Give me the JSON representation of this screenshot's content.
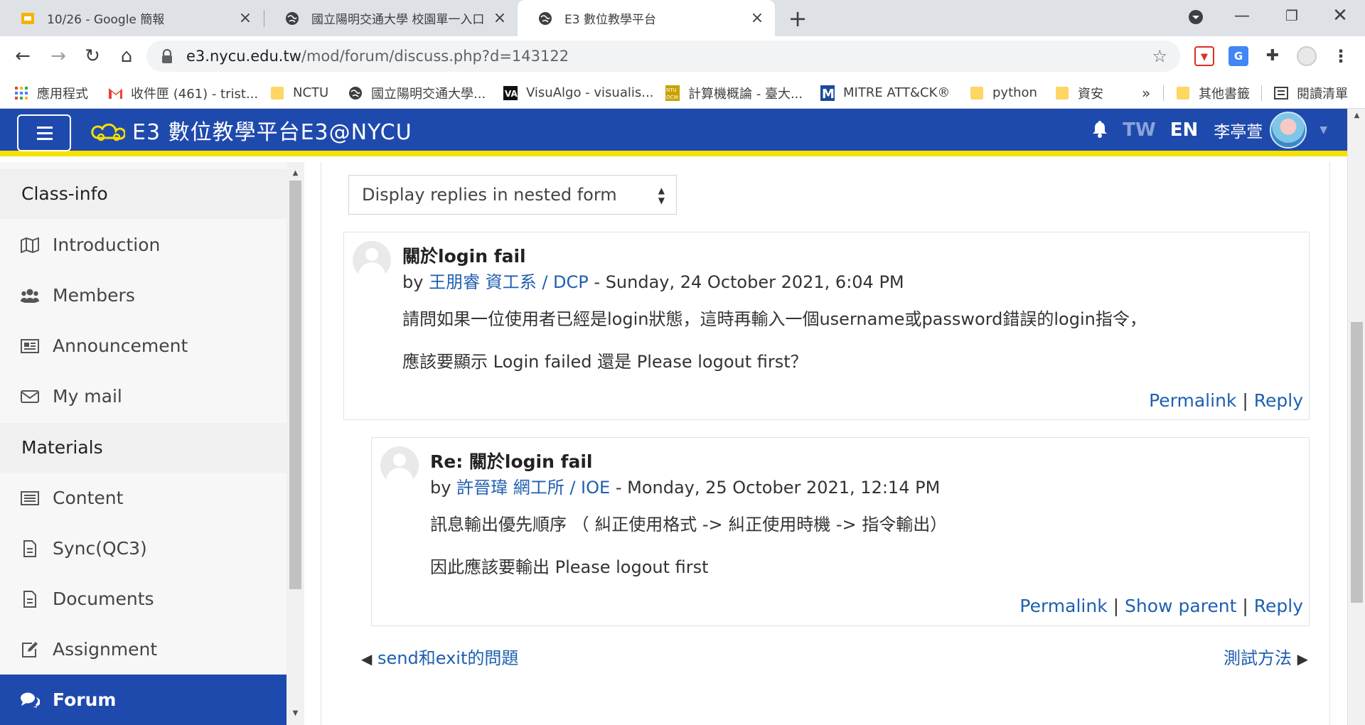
{
  "browser": {
    "tabs": [
      {
        "title": "10/26 - Google 簡報",
        "icon": "google-slides-icon"
      },
      {
        "title": "國立陽明交通大學 校園單一入口",
        "icon": "globe-icon"
      },
      {
        "title": "E3 數位教學平台",
        "icon": "globe-icon",
        "active": true
      }
    ],
    "url_host": "e3.nycu.edu.tw",
    "url_path": "/mod/forum/discuss.php?d=143122",
    "bookmarks": [
      {
        "label": "應用程式",
        "icon": "apps-grid-icon"
      },
      {
        "label": "收件匣 (461) - trist...",
        "icon": "gmail-icon"
      },
      {
        "label": "NCTU",
        "icon": "folder-icon"
      },
      {
        "label": "國立陽明交通大學...",
        "icon": "globe-icon"
      },
      {
        "label": "VisuAlgo - visualis...",
        "icon": "visualgo-icon"
      },
      {
        "label": "計算機概論 - 臺大...",
        "icon": "ntu-ocw-icon"
      },
      {
        "label": "MITRE ATT&CK®",
        "icon": "mitre-icon"
      },
      {
        "label": "python",
        "icon": "folder-icon"
      },
      {
        "label": "資安",
        "icon": "folder-icon"
      }
    ],
    "bookmarks_overflow": "»",
    "other_bookmarks": "其他書籤",
    "reading_list": "閱讀清單"
  },
  "app": {
    "brand": "E3 數位教學平台E3@NYCU",
    "lang_tw": "TW",
    "lang_en": "EN",
    "user_name": "李亭萱"
  },
  "sidebar": {
    "section_classinfo": "Class-info",
    "introduction": "Introduction",
    "members": "Members",
    "announcement": "Announcement",
    "mymail": "My mail",
    "section_materials": "Materials",
    "content": "Content",
    "sync": "Sync(QC3)",
    "documents": "Documents",
    "assignment": "Assignment",
    "forum": "Forum"
  },
  "discussion": {
    "display_mode": "Display replies in nested form",
    "posts": [
      {
        "subject": "關於login fail",
        "by": "by",
        "author": "王朋睿 資工系 / DCP",
        "date": "- Sunday, 24 October 2021, 6:04 PM",
        "para1": "請問如果一位使用者已經是login狀態，這時再輸入一個username或password錯誤的login指令，",
        "para2": "應該要顯示 Login failed 還是 Please logout first？",
        "permalink": "Permalink",
        "reply": "Reply",
        "sep": "|"
      },
      {
        "subject": "Re: 關於login fail",
        "by": "by",
        "author": "許晉瑋 網工所 / IOE",
        "date": "- Monday, 25 October 2021, 12:14 PM",
        "para1": "訊息輸出優先順序 （ 糾正使用格式 -> 糾正使用時機 -> 指令輸出）",
        "para2": "因此應該要輸出 Please logout first",
        "permalink": "Permalink",
        "show_parent": "Show parent",
        "reply": "Reply",
        "sep": "|"
      }
    ],
    "prev_discussion": "send和exit的問題",
    "next_discussion": "測試方法"
  },
  "colors": {
    "header_blue": "#1f4aad",
    "header_yellow": "#f5e100",
    "link_blue": "#1f5fb0"
  }
}
